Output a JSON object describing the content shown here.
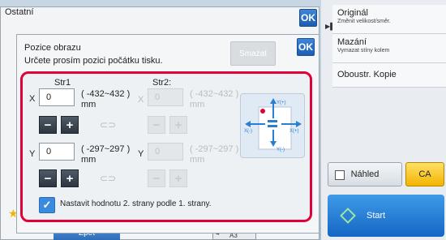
{
  "back_dialog": {
    "title": "Ostatní",
    "ok_label": "OK"
  },
  "right_panel": {
    "items": [
      {
        "title": "Originál",
        "subtitle": "Změnit velikost/směr."
      },
      {
        "title": "Mazání",
        "subtitle": "Vymazat stíny kolem"
      },
      {
        "title": "Oboustr. Kopie",
        "subtitle": ""
      }
    ],
    "preview_label": "Náhled",
    "ca_label": "CA",
    "start_label": "Start"
  },
  "bottom": {
    "back_label": "Zpět",
    "paper_number": "4",
    "paper_size": "A3"
  },
  "dialog": {
    "title": "Pozice obrazu",
    "subtitle": "Určete prosím pozici počátku tisku.",
    "ok_label": "OK",
    "clear_label": "Smazat",
    "side1_label": "Str1",
    "side2_label": "Str2:",
    "x_label": "X",
    "y_label": "Y",
    "side1": {
      "x_value": "0",
      "x_range": "( -432~432 )",
      "x_unit": "mm",
      "y_value": "0",
      "y_range": "( -297~297 )",
      "y_unit": "mm"
    },
    "side2": {
      "x_value": "0",
      "x_range": "( -432~432 )",
      "x_unit": "mm",
      "y_value": "0",
      "y_range": "( -297~297 )",
      "y_unit": "mm"
    },
    "minus": "−",
    "plus": "+",
    "link_symbol": "⊂⊃",
    "checkbox_label": "Nastavit hodnotu 2. strany podle 1. strany.",
    "checkbox_checked": true,
    "diagram": {
      "y_pos": "Y(+)",
      "y_neg": "Y(-)",
      "x_pos": "X(+)",
      "x_neg": "X(-)"
    }
  },
  "colors": {
    "highlight": "#e0003a",
    "accent": "#1c5db0",
    "ca": "#f2b400"
  }
}
